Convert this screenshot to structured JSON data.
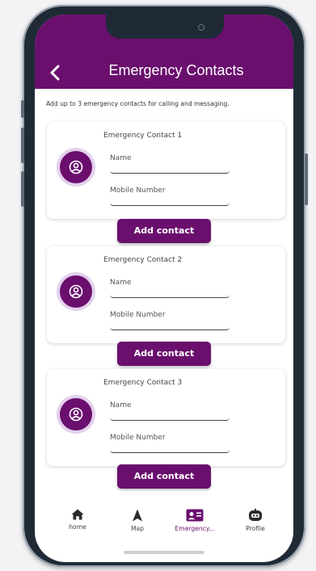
{
  "header": {
    "title": "Emergency Contacts",
    "back_icon": "chevron-left-icon"
  },
  "intro_text": "Add up to 3 emergency contacts for calling and messaging.",
  "contacts": [
    {
      "title": "Emergency Contact 1",
      "name_label": "Name",
      "mobile_label": "Mobile Number",
      "button_label": "Add contact"
    },
    {
      "title": "Emergency Contact 2",
      "name_label": "Name",
      "mobile_label": "Mobile Number",
      "button_label": "Add contact"
    },
    {
      "title": "Emergency Contact 3",
      "name_label": "Name",
      "mobile_label": "Mobile Number",
      "button_label": "Add contact"
    }
  ],
  "bottom_nav": [
    {
      "label": "home",
      "icon": "home-icon"
    },
    {
      "label": "Map",
      "icon": "navigation-arrow-icon"
    },
    {
      "label": "Emergency...",
      "icon": "contact-card-icon",
      "active": true
    },
    {
      "label": "Profile",
      "icon": "robot-face-icon"
    }
  ],
  "colors": {
    "primary": "#6a0f6e",
    "avatar_ring": "#e3d1ec",
    "background": "#ffffff"
  }
}
